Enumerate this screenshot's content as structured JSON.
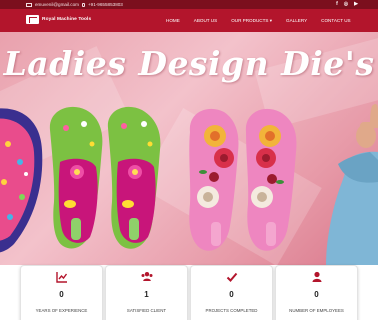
{
  "topbar": {
    "email": "emuvenil@gmail.com",
    "phone": "+91-9655853803",
    "social": [
      {
        "name": "facebook-icon",
        "glyph": "f"
      },
      {
        "name": "instagram-icon",
        "glyph": "◎"
      },
      {
        "name": "youtube-icon",
        "glyph": "▶"
      }
    ]
  },
  "brand": {
    "name": "Royal Machine Tools"
  },
  "nav": {
    "items": [
      "HOME",
      "ABOUT US",
      "OUR PRODUCTS ▾",
      "GALLERY",
      "CONTACT US"
    ]
  },
  "hero": {
    "title": "Ladies Design Die's"
  },
  "stats": [
    {
      "value": "0",
      "label": "YEARS OF EXPERIENCE",
      "icon": "chart-icon"
    },
    {
      "value": "1",
      "label": "SATISFIED CLIENT",
      "icon": "users-icon"
    },
    {
      "value": "0",
      "label": "PROJECTS COMPLETED",
      "icon": "check-icon"
    },
    {
      "value": "0",
      "label": "NUMBER OF EMPLOYEES",
      "icon": "user-icon"
    }
  ],
  "colors": {
    "topbar": "#7b0f1d",
    "navbar": "#b3152c",
    "icon": "#b3152c"
  }
}
